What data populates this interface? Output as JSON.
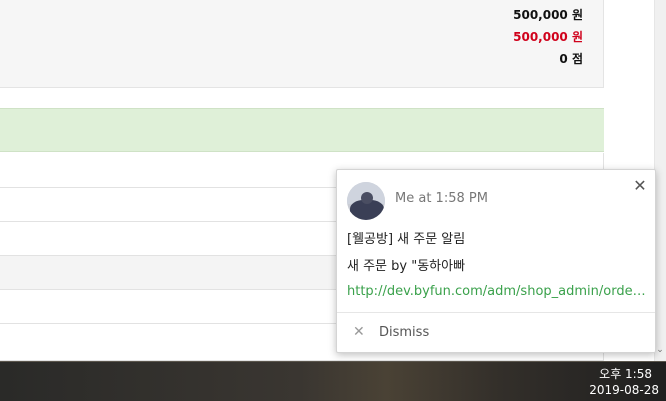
{
  "summary": {
    "rows": [
      {
        "text": "500,000 원",
        "color": "#111111"
      },
      {
        "text": "500,000 원",
        "color": "#d0011b"
      },
      {
        "text": "0 점",
        "color": "#111111"
      }
    ]
  },
  "notification": {
    "sender_time": "Me at 1:58 PM",
    "title": "[웰공방] 새 주문 알림",
    "body": "새 주문 by \"동하아빠",
    "link": "http://dev.byfun.com/adm/shop_admin/orderform.php",
    "dismiss_label": "Dismiss",
    "close_icon": "close-icon",
    "link_color": "#3aa14b"
  },
  "taskbar": {
    "time": "오후 1:58",
    "date": "2019-08-28"
  },
  "colors": {
    "success_band": "#dff0d8",
    "alert_red": "#d0011b"
  }
}
